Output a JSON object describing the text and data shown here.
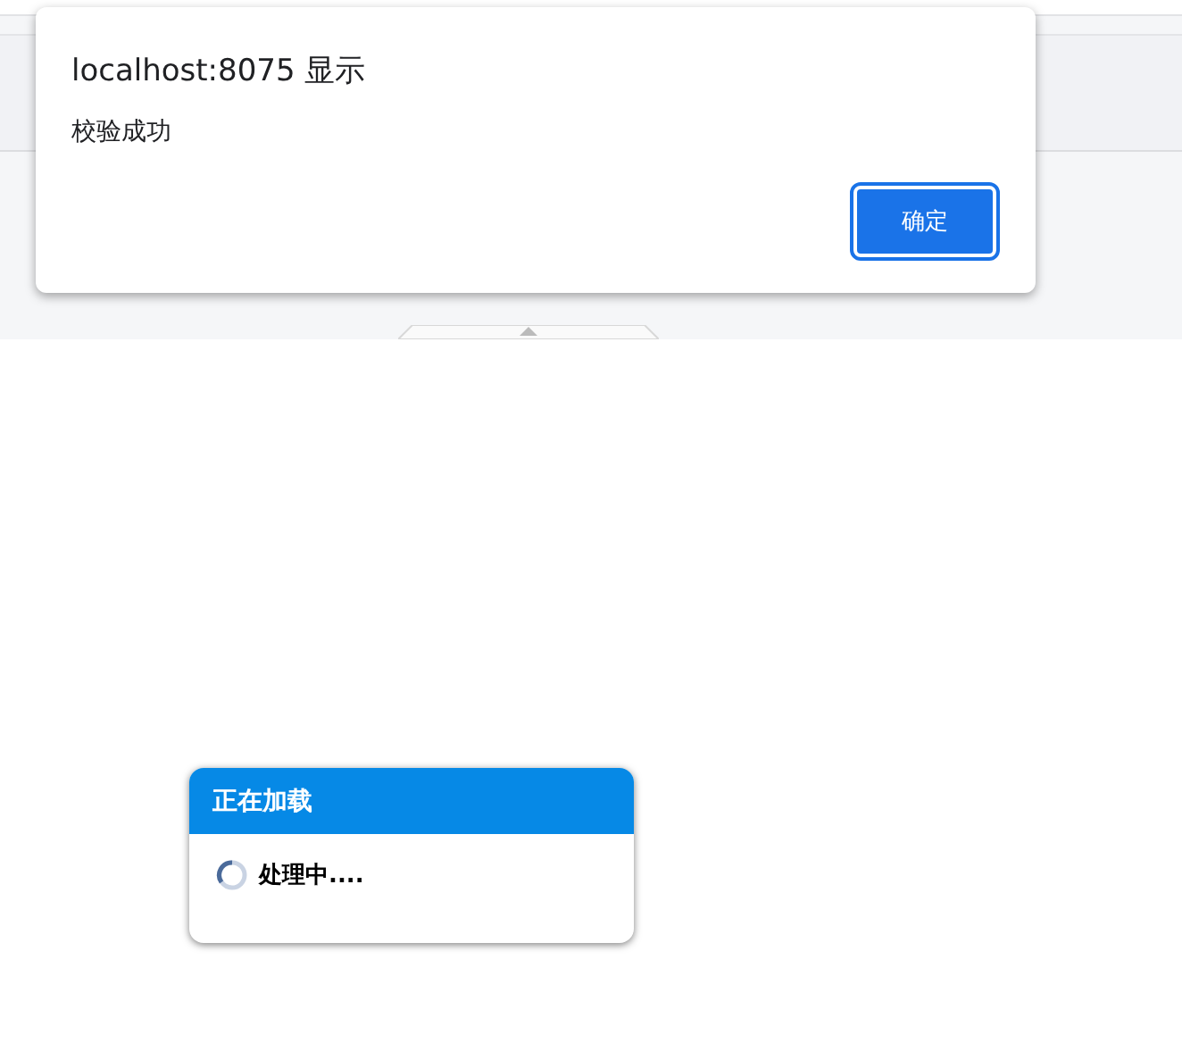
{
  "alert": {
    "title": "localhost:8075 显示",
    "message": "校验成功",
    "button": "确定"
  },
  "loading": {
    "title": "正在加载",
    "message": "处理中...."
  }
}
